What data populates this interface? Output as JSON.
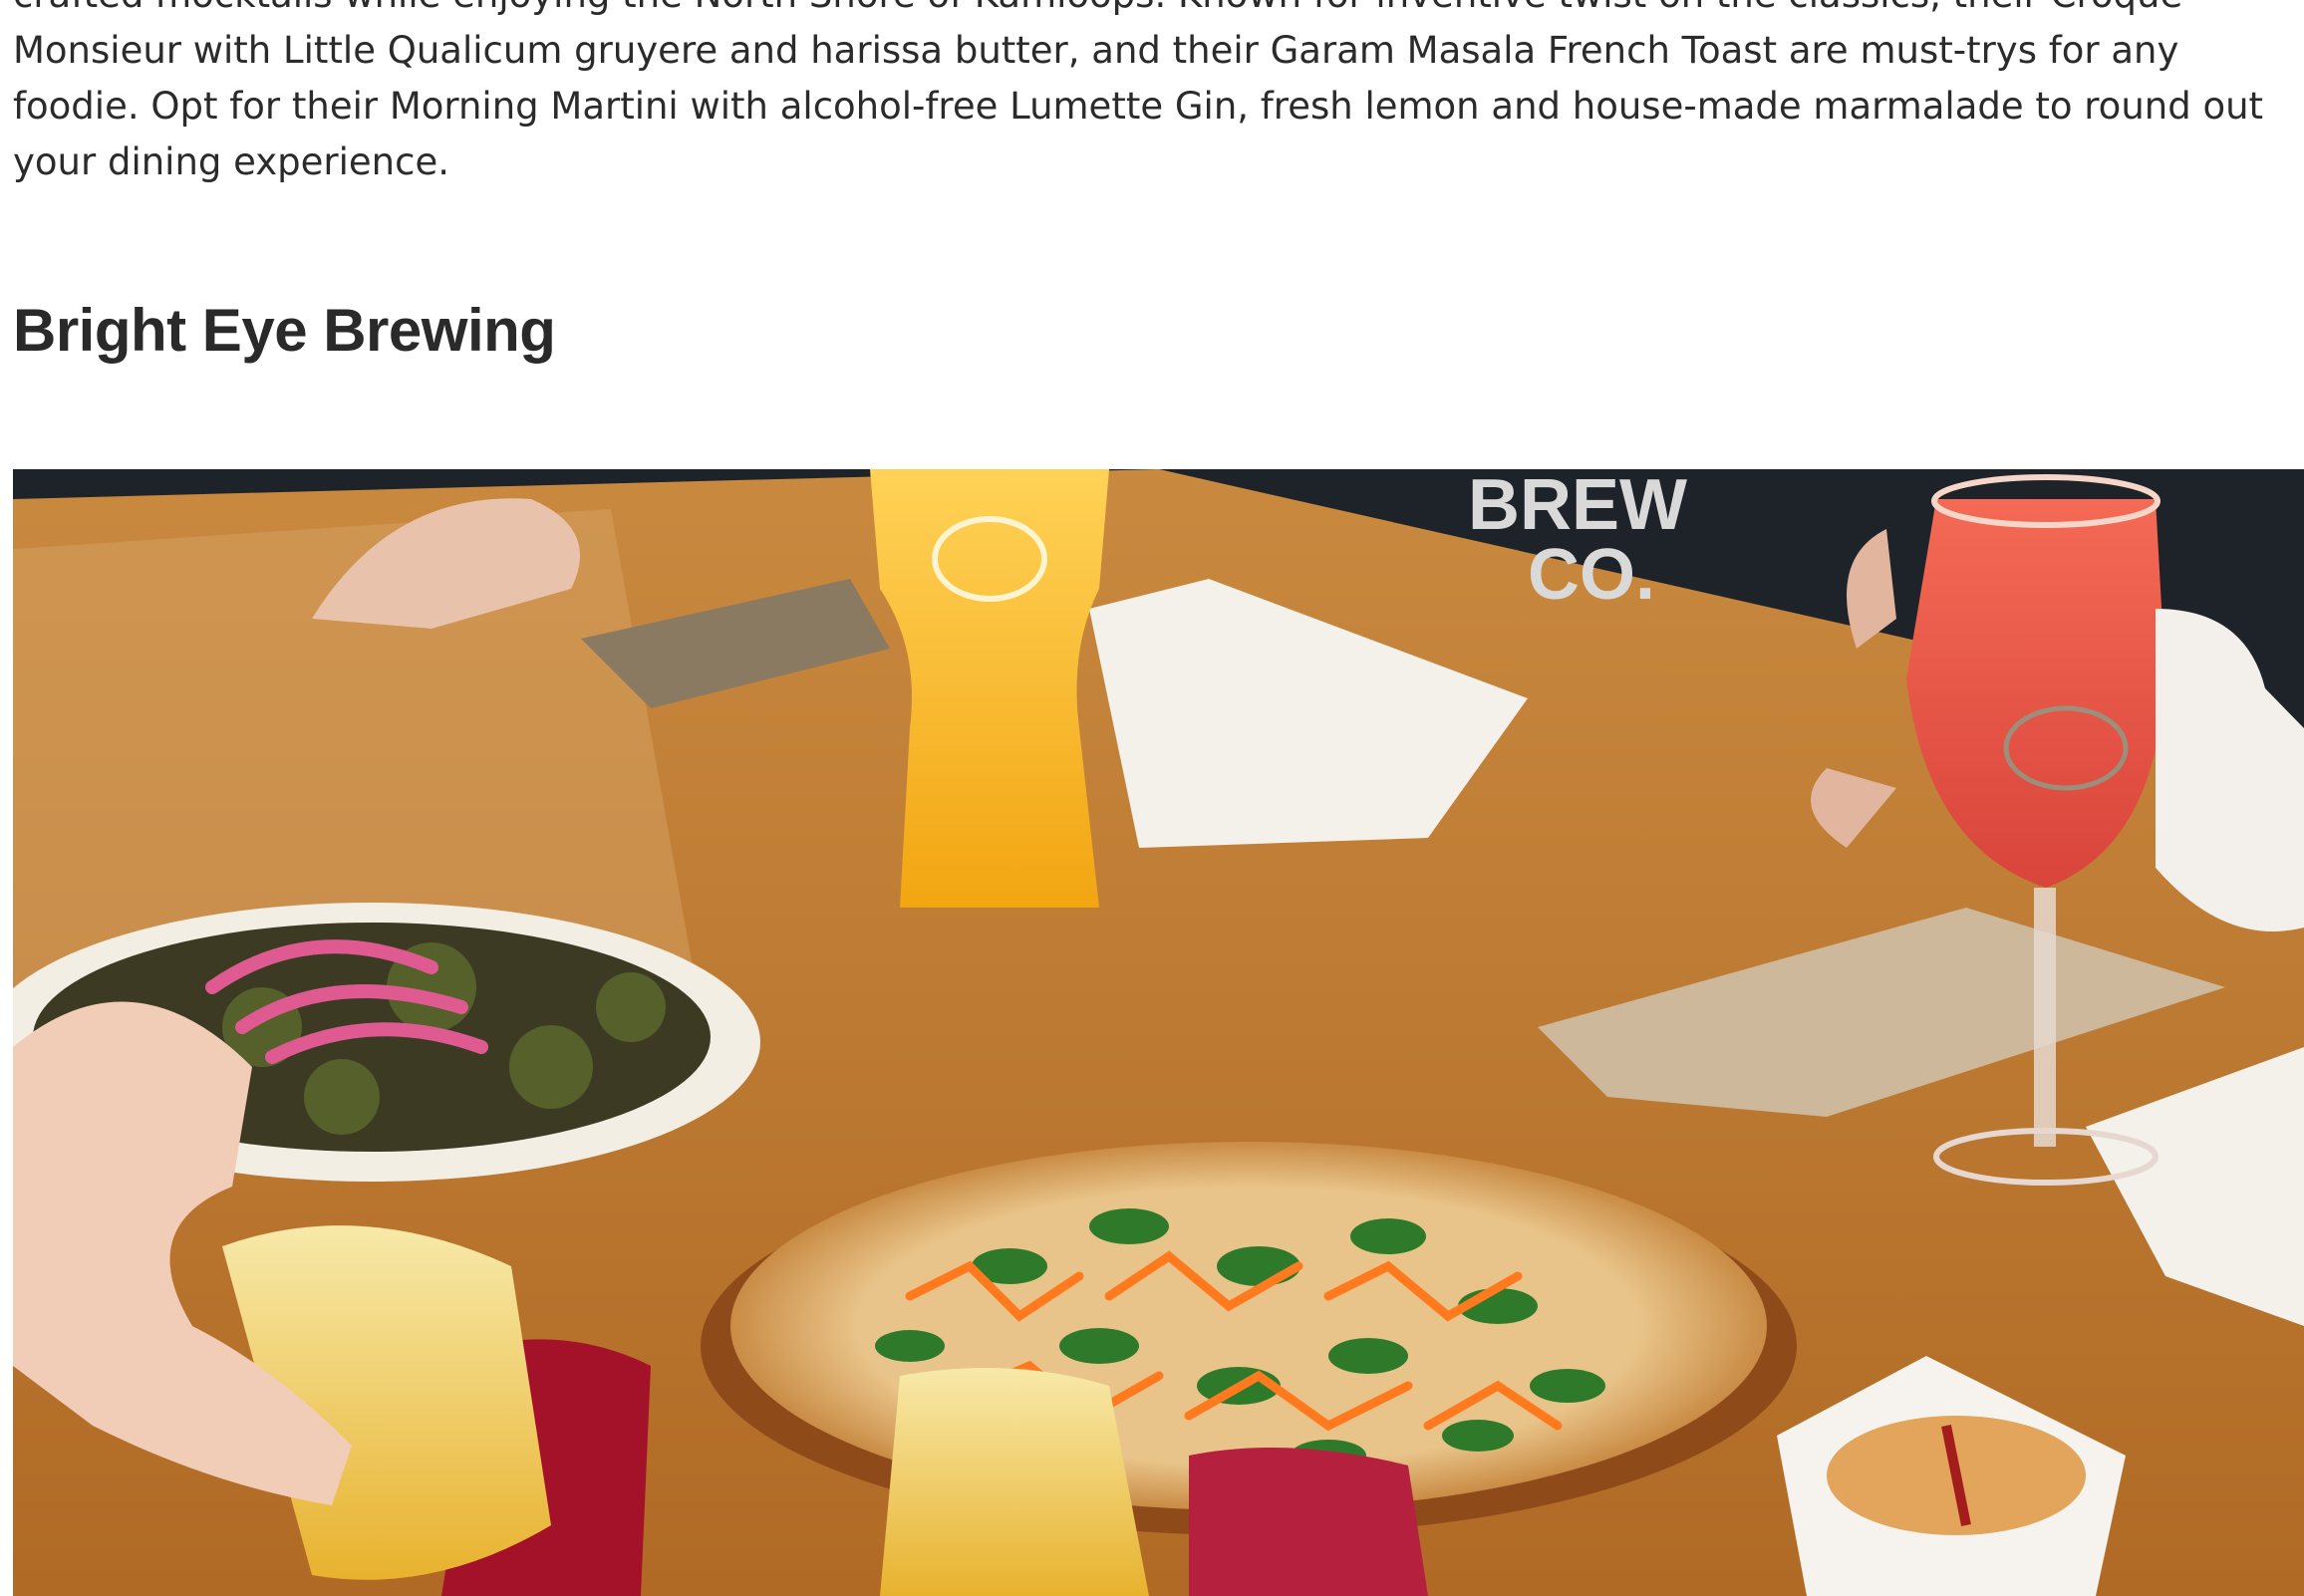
{
  "article": {
    "intro_text": "crafted mocktails while enjoying the North Shore of Kamloops. Known for inventive twist on the classics, their Croque Monsieur with Little Qualicum gruyere and harissa butter, and their Garam Masala French Toast are must-trys for any foodie. Opt for their Morning Martini with alcohol-free Lumette Gin, fresh lemon and house-made marmalade to round out your dining experience.",
    "section_heading": "Bright Eye Brewing"
  },
  "photo": {
    "wordmark_line1": "BREW",
    "wordmark_line2": "CO."
  }
}
